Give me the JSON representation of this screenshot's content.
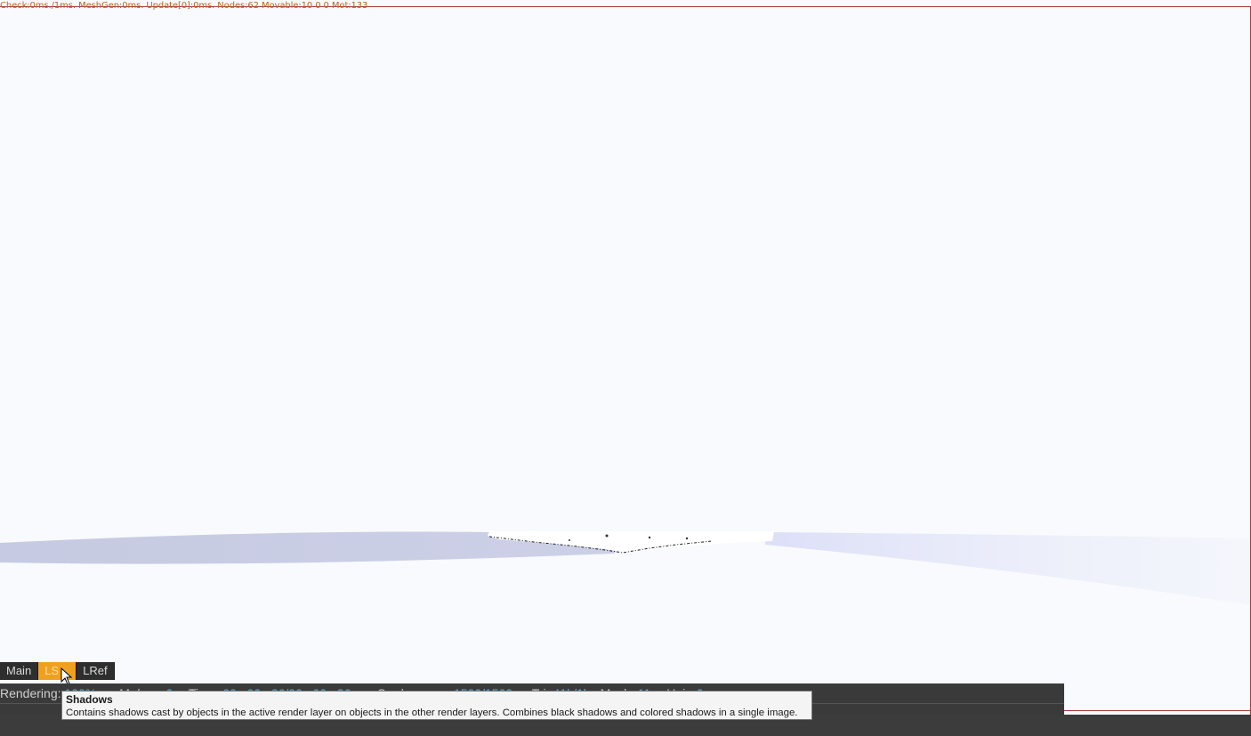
{
  "debug": {
    "text": "Check:0ms./1ms. MeshGen:0ms. Update[0]:0ms. Nodes:62 Movable:10  0 0 Mot:133"
  },
  "layer_tabs": [
    {
      "label": "Main",
      "active": false
    },
    {
      "label": "LS",
      "active": true
    },
    {
      "label": "LRef",
      "active": false
    }
  ],
  "status": {
    "rendering_label": "Rendering:",
    "rendering_value": "100%",
    "mssec_label": "Ms/sec:",
    "mssec_value": "0",
    "time_label": "Time:",
    "time_value": "00 : 00 : 36/00 : 00 : 36",
    "spp_label": "Spp/maxspp:",
    "spp_value": "1500/1500",
    "tri_label": "Tri:",
    "tri_value": "41k/1k",
    "mesh_label": "Mesh:",
    "mesh_value": "11",
    "hair_label": "Hair:",
    "hair_value": "0"
  },
  "tooltip": {
    "title": "Shadows",
    "description": "Contains shadows cast by objects in the active render layer on objects in the other render layers. Combines black shadows and colored shadows in a single image."
  },
  "colors": {
    "active_tab": "#f0a020",
    "status_value": "#5fb0d8",
    "border": "#a83a3a"
  }
}
